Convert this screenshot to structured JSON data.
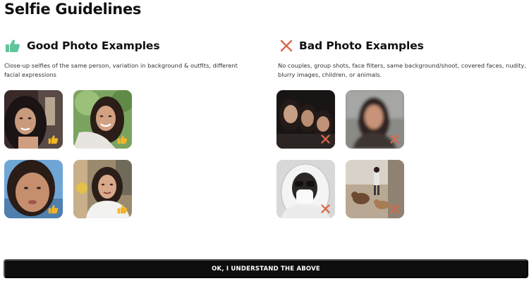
{
  "page": {
    "title": "Selfie Guidelines"
  },
  "good": {
    "heading": "Good Photo Examples",
    "icon": "thumbs-up-icon",
    "icon_color": "#5fc59a",
    "description": "Close-up selfies of the same person, variation in background & outfits, different facial expressions",
    "photos": [
      {
        "subject": "close-up selfie, dark hair, warm light",
        "badge": "thumbs-up-badge-icon"
      },
      {
        "subject": "smiling selfie outdoors, greenery",
        "badge": "thumbs-up-badge-icon"
      },
      {
        "subject": "close-up selfie, blue sky background",
        "badge": "thumbs-up-badge-icon"
      },
      {
        "subject": "selfie with white scarf, outdoors",
        "badge": "thumbs-up-badge-icon"
      }
    ],
    "badge_color": "#f0b429"
  },
  "bad": {
    "heading": "Bad Photo Examples",
    "icon": "x-mark-icon",
    "icon_color": "#d9684a",
    "description": "No couples, group shots, face filters, same background/shoot, covered faces, nudity, blurry images, children, or animals.",
    "photos": [
      {
        "subject": "group shot of three people, dark",
        "badge": "x-badge-icon"
      },
      {
        "subject": "blurry selfie",
        "badge": "x-badge-icon"
      },
      {
        "subject": "covered face with hood and sunglasses",
        "badge": "x-badge-icon"
      },
      {
        "subject": "person far away with dogs",
        "badge": "x-badge-icon"
      }
    ],
    "badge_color": "#d9684a"
  },
  "actions": {
    "confirm_label": "OK, I UNDERSTAND THE ABOVE"
  }
}
